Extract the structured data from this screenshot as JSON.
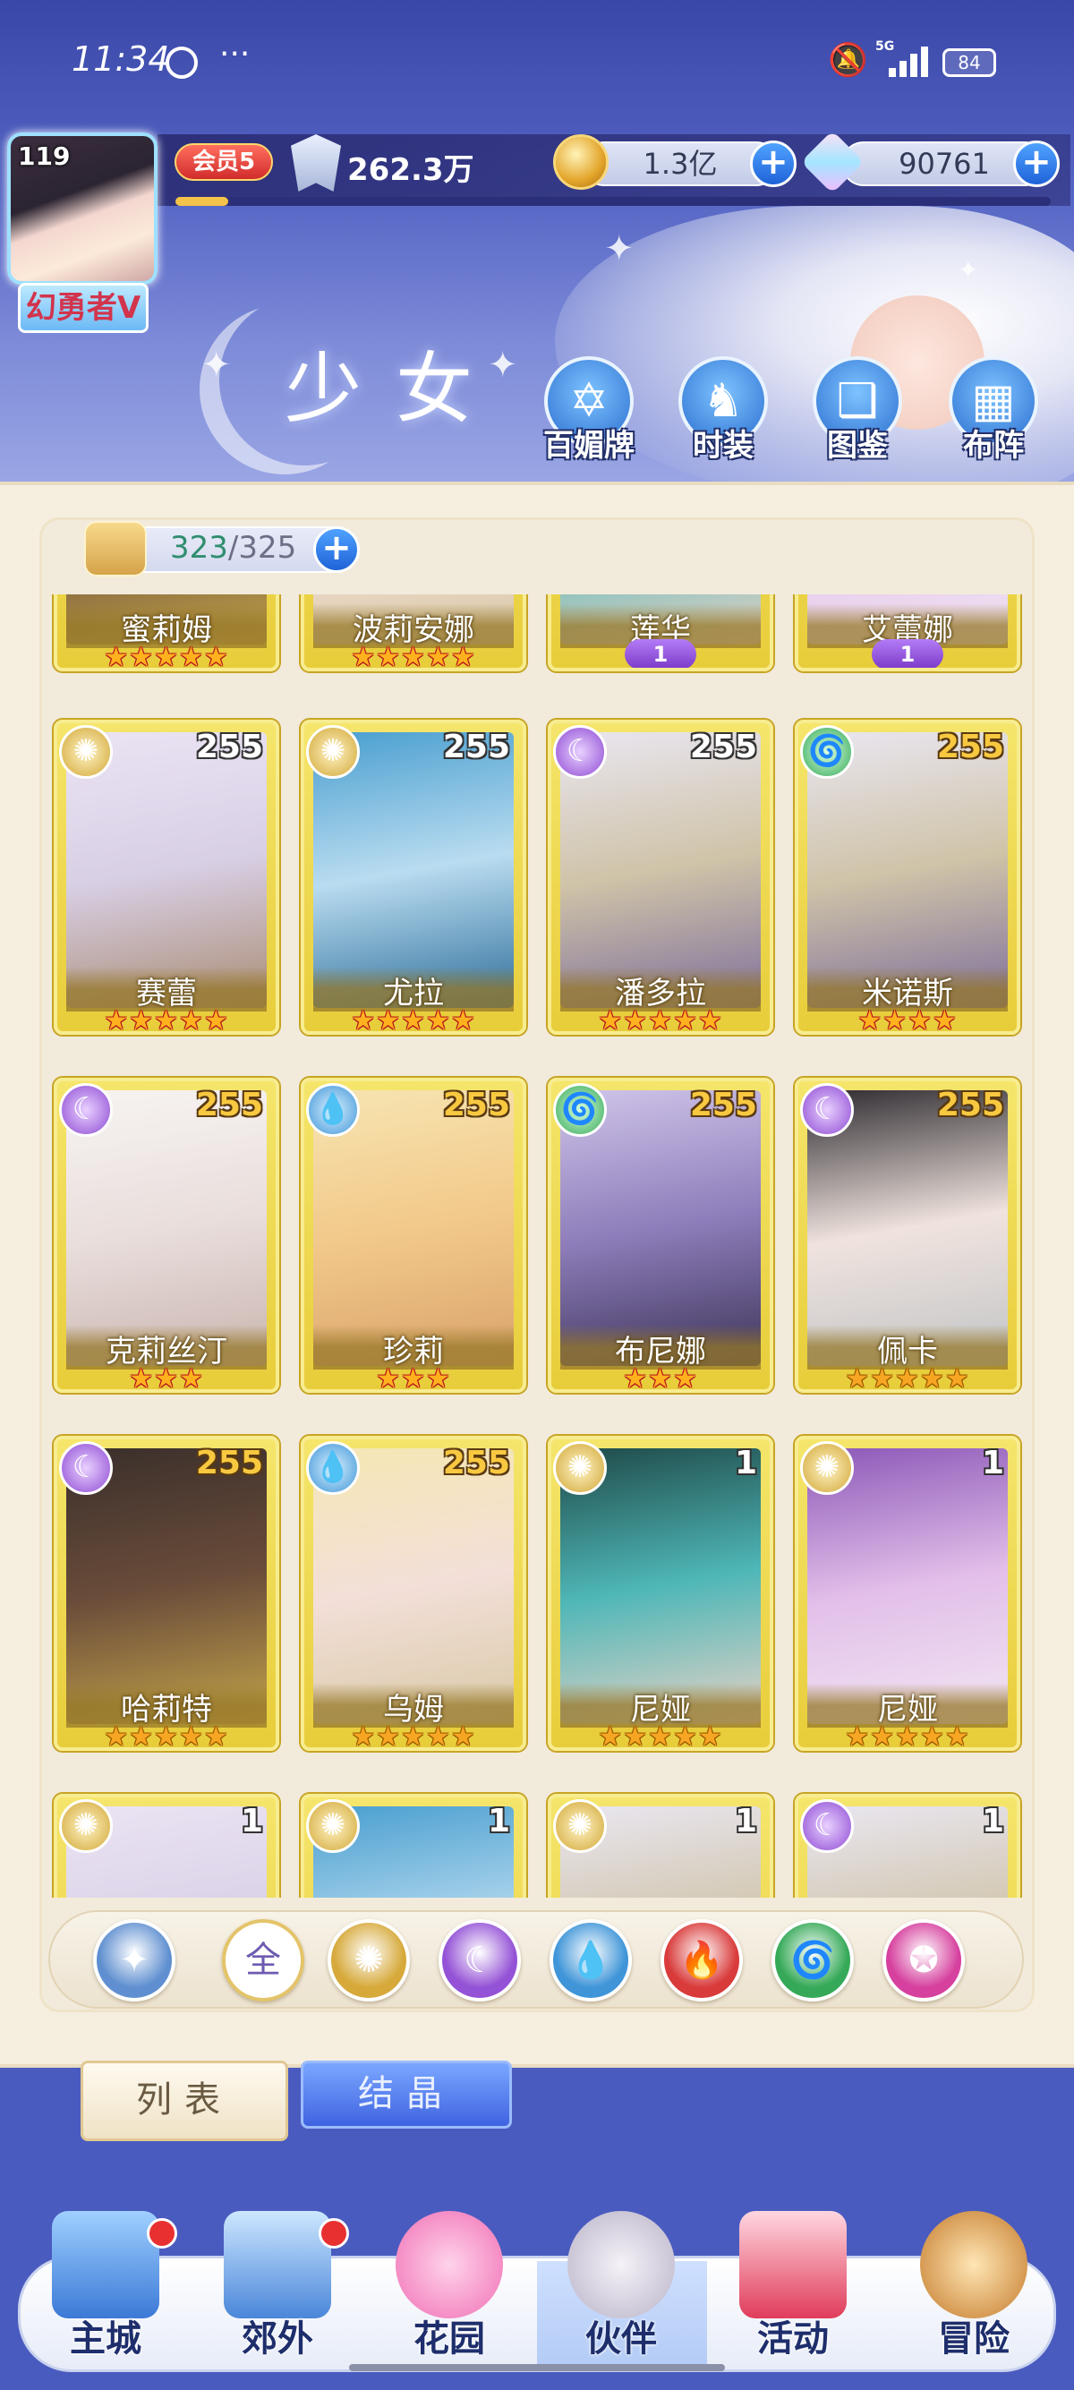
{
  "status_bar": {
    "time": "11:34",
    "more": "···",
    "network": "5G",
    "battery": "84"
  },
  "player": {
    "level": "119",
    "title": "幻勇者V",
    "vip": "会员5",
    "power": "262.3万",
    "xp_progress": 0.06
  },
  "currencies": {
    "gold": "1.3亿",
    "gems": "90761",
    "plus": "+"
  },
  "page_title": "少女",
  "nav_buttons": [
    {
      "label": "百媚牌",
      "icon": "card-icon",
      "glyph": "✡"
    },
    {
      "label": "时装",
      "icon": "fashion-icon",
      "glyph": "♞"
    },
    {
      "label": "图鉴",
      "icon": "book-icon",
      "glyph": "❑"
    },
    {
      "label": "布阵",
      "icon": "grid-icon",
      "glyph": "▦"
    }
  ],
  "capacity": {
    "current": "323",
    "separator": "/",
    "max": "325"
  },
  "characters": [
    {
      "name": "蜜莉姆",
      "stars": 5,
      "row": 0,
      "col": 0
    },
    {
      "name": "波莉安娜",
      "stars": 5,
      "row": 0,
      "col": 1
    },
    {
      "name": "莲华",
      "awake": "1",
      "row": 0,
      "col": 2
    },
    {
      "name": "艾蕾娜",
      "awake": "1",
      "row": 0,
      "col": 3
    },
    {
      "name": "赛蕾",
      "level": "255",
      "element": "light",
      "stars": 5,
      "row": 1,
      "col": 0,
      "lvl_white": true
    },
    {
      "name": "尤拉",
      "level": "255",
      "element": "light",
      "stars": 5,
      "row": 1,
      "col": 1,
      "lvl_white": true
    },
    {
      "name": "潘多拉",
      "level": "255",
      "element": "dark",
      "stars": 5,
      "row": 1,
      "col": 2,
      "lvl_white": true
    },
    {
      "name": "米诺斯",
      "level": "255",
      "element": "wind",
      "stars": 4,
      "row": 1,
      "col": 3
    },
    {
      "name": "克莉丝汀",
      "level": "255",
      "element": "dark",
      "stars": 3,
      "row": 2,
      "col": 0
    },
    {
      "name": "珍莉",
      "level": "255",
      "element": "water",
      "stars": 3,
      "row": 2,
      "col": 1
    },
    {
      "name": "布尼娜",
      "level": "255",
      "element": "wind",
      "stars": 3,
      "row": 2,
      "col": 2
    },
    {
      "name": "佩卡",
      "level": "255",
      "element": "dark",
      "stars": 5,
      "row": 2,
      "col": 3,
      "orange": true
    },
    {
      "name": "哈莉特",
      "level": "255",
      "element": "dark",
      "stars": 5,
      "row": 3,
      "col": 0,
      "orange": true
    },
    {
      "name": "乌姆",
      "level": "255",
      "element": "water",
      "stars": 5,
      "row": 3,
      "col": 1,
      "orange": true
    },
    {
      "name": "尼娅",
      "level": "1",
      "element": "light",
      "stars": 5,
      "row": 3,
      "col": 2,
      "orange": true,
      "lvl_white": true
    },
    {
      "name": "尼娅",
      "level": "1",
      "element": "light",
      "stars": 5,
      "row": 3,
      "col": 3,
      "orange": true,
      "lvl_white": true
    },
    {
      "name": "",
      "level": "1",
      "element": "light",
      "row": 4,
      "col": 0,
      "lvl_white": true
    },
    {
      "name": "",
      "level": "1",
      "element": "light",
      "row": 4,
      "col": 1,
      "lvl_white": true
    },
    {
      "name": "",
      "level": "1",
      "element": "light",
      "row": 4,
      "col": 2,
      "lvl_white": true
    },
    {
      "name": "",
      "level": "1",
      "element": "dark",
      "row": 4,
      "col": 3,
      "lvl_white": true
    }
  ],
  "filters": [
    {
      "name": "filter-rarity",
      "glyph": "✦",
      "color": "#5f8fd0"
    },
    {
      "name": "filter-all",
      "glyph": "全",
      "color": "#ffffff",
      "text_color": "#6e5bb0"
    },
    {
      "name": "filter-light",
      "glyph": "✺",
      "color": "#d6a93a"
    },
    {
      "name": "filter-dark",
      "glyph": "☾",
      "color": "#9452d6"
    },
    {
      "name": "filter-water",
      "glyph": "💧",
      "color": "#3f95d8"
    },
    {
      "name": "filter-fire",
      "glyph": "🔥",
      "color": "#d93a3a"
    },
    {
      "name": "filter-wind",
      "glyph": "🌀",
      "color": "#35a957"
    },
    {
      "name": "filter-star",
      "glyph": "✪",
      "color": "#d6409e"
    }
  ],
  "tabs": {
    "list": "列表",
    "crystal": "结晶"
  },
  "bottom_nav": [
    {
      "key": "main-city",
      "label": "主城",
      "badge": true
    },
    {
      "key": "outskirts",
      "label": "郊外",
      "badge": true
    },
    {
      "key": "garden",
      "label": "花园",
      "badge": false
    },
    {
      "key": "partner",
      "label": "伙伴",
      "badge": false
    },
    {
      "key": "activity",
      "label": "活动",
      "badge": false
    },
    {
      "key": "adventure",
      "label": "冒险",
      "badge": false
    }
  ],
  "colors": {
    "accent_blue": "#2b6fd0",
    "card_gold": "#e8cd3a",
    "star_red": "#b8171d",
    "vip_red": "#d12c2c"
  }
}
